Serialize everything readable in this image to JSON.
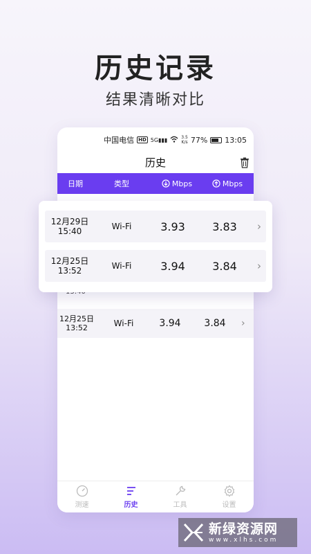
{
  "hero": {
    "title": "历史记录",
    "subtitle": "结果清晰对比"
  },
  "status_bar": {
    "carrier": "中国电信",
    "hd": "HD",
    "signal_label": "5G",
    "speed_top": "3.5",
    "speed_unit": "K/s",
    "battery": "77%",
    "time": "13:05"
  },
  "app": {
    "title": "历史",
    "icon": "trash-icon"
  },
  "table": {
    "headers": {
      "date": "日期",
      "type": "类型",
      "down": "Mbps",
      "up": "Mbps"
    },
    "ghost_time": "13:40",
    "rows": [
      {
        "date": "12月25日",
        "time": "13:52",
        "type": "Wi-Fi",
        "down": "3.94",
        "up": "3.84"
      }
    ]
  },
  "card": {
    "rows": [
      {
        "date": "12月29日",
        "time": "15:40",
        "type": "Wi-Fi",
        "down": "3.93",
        "up": "3.83"
      },
      {
        "date": "12月25日",
        "time": "13:52",
        "type": "Wi-Fi",
        "down": "3.94",
        "up": "3.84"
      }
    ]
  },
  "nav": {
    "items": [
      {
        "label": "测速",
        "icon": "speedometer-icon"
      },
      {
        "label": "历史",
        "icon": "list-icon"
      },
      {
        "label": "工具",
        "icon": "wrench-icon"
      },
      {
        "label": "设置",
        "icon": "gear-icon"
      }
    ]
  },
  "watermark": {
    "name": "新绿资源网",
    "url": "www.xlhs.com"
  },
  "colors": {
    "accent": "#6a3df0",
    "row_bg": "#f4f3f8"
  }
}
